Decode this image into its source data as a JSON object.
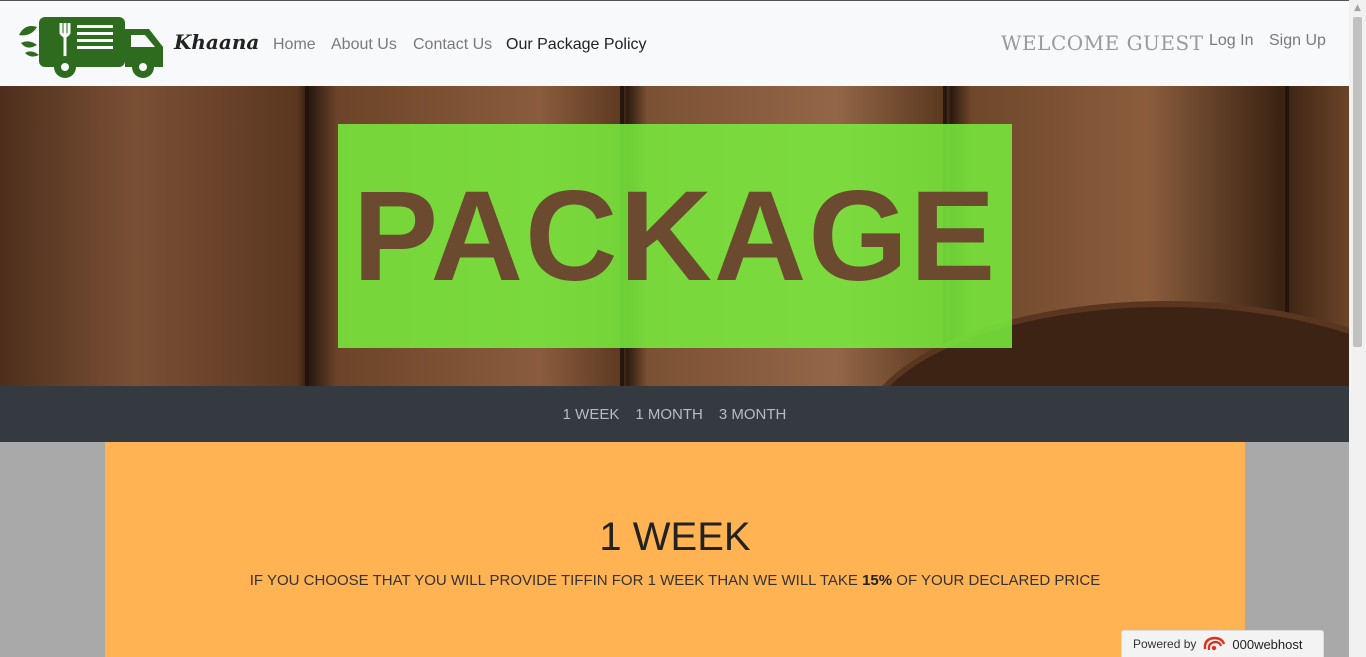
{
  "navbar": {
    "brand": "Khaana",
    "links": [
      "Home",
      "About Us",
      "Contact Us",
      "Our Package Policy"
    ],
    "welcome": "WELCOME GUEST",
    "login": "Log In",
    "signup": "Sign Up"
  },
  "hero": {
    "title": "PACKAGE"
  },
  "tabs": [
    "1 WEEK",
    "1 MONTH",
    "3 MONTH"
  ],
  "card": {
    "title": "1 WEEK",
    "text_before": "IF YOU CHOOSE THAT YOU WILL PROVIDE TIFFIN FOR 1 WEEK THAN WE WILL TAKE ",
    "text_bold": "15%",
    "text_after": " OF YOUR DECLARED PRICE"
  },
  "badge": {
    "prefix": "Powered by",
    "brand": "000webhost"
  },
  "colors": {
    "logo_green": "#2e6b1f",
    "hero_box": "#78ee3c",
    "card": "#ffb352",
    "tabs_bar": "#343a40"
  }
}
